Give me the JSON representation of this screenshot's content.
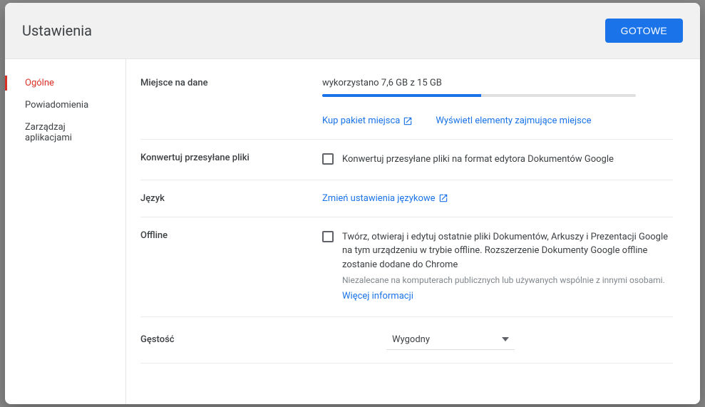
{
  "header": {
    "title": "Ustawienia",
    "done": "GOTOWE"
  },
  "sidebar": {
    "items": [
      {
        "label": "Ogólne"
      },
      {
        "label": "Powiadomienia"
      },
      {
        "label": "Zarządzaj aplikacjami"
      }
    ]
  },
  "storage": {
    "label": "Miejsce na dane",
    "usage_text": "wykorzystano 7,6 GB z 15 GB",
    "used_gb": 7.6,
    "total_gb": 15,
    "buy_link": "Kup pakiet miejsca",
    "view_link": "Wyświetl elementy zajmujące miejsce"
  },
  "convert": {
    "label": "Konwertuj przesyłane pliki",
    "checkbox_text": "Konwertuj przesyłane pliki na format edytora Dokumentów Google",
    "checked": false
  },
  "language": {
    "label": "Język",
    "link": "Zmień ustawienia językowe"
  },
  "offline": {
    "label": "Offline",
    "checkbox_text": "Twórz, otwieraj i edytuj ostatnie pliki Dokumentów, Arkuszy i Prezentacji Google na tym urządzeniu w trybie offline. Rozszerzenie Dokumenty Google offline zostanie dodane do Chrome",
    "hint": "Niezalecane na komputerach publicznych lub używanych wspólnie z innymi osobami.",
    "more": "Więcej informacji",
    "checked": false
  },
  "density": {
    "label": "Gęstość",
    "selected": "Wygodny"
  }
}
